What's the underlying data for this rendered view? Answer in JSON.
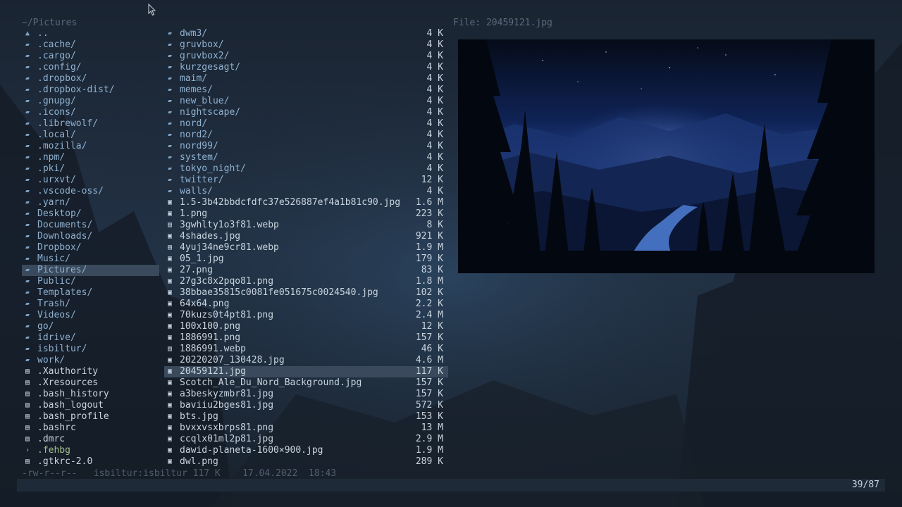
{
  "header": {
    "path": "~/Pictures",
    "preview_title": "File: 20459121.jpg"
  },
  "left_column": [
    {
      "name": "..",
      "type": "parent"
    },
    {
      "name": ".cache/",
      "type": "dir"
    },
    {
      "name": ".cargo/",
      "type": "dir"
    },
    {
      "name": ".config/",
      "type": "dir"
    },
    {
      "name": ".dropbox/",
      "type": "dir"
    },
    {
      "name": ".dropbox-dist/",
      "type": "dir"
    },
    {
      "name": ".gnupg/",
      "type": "dir"
    },
    {
      "name": ".icons/",
      "type": "dir"
    },
    {
      "name": ".librewolf/",
      "type": "dir"
    },
    {
      "name": ".local/",
      "type": "dir"
    },
    {
      "name": ".mozilla/",
      "type": "dir"
    },
    {
      "name": ".npm/",
      "type": "dir"
    },
    {
      "name": ".pki/",
      "type": "dir"
    },
    {
      "name": ".urxvt/",
      "type": "dir"
    },
    {
      "name": ".vscode-oss/",
      "type": "dir"
    },
    {
      "name": ".yarn/",
      "type": "dir"
    },
    {
      "name": "Desktop/",
      "type": "dir"
    },
    {
      "name": "Documents/",
      "type": "dir"
    },
    {
      "name": "Downloads/",
      "type": "dir"
    },
    {
      "name": "Dropbox/",
      "type": "dir"
    },
    {
      "name": "Music/",
      "type": "dir"
    },
    {
      "name": "Pictures/",
      "type": "dir",
      "selected": true
    },
    {
      "name": "Public/",
      "type": "dir"
    },
    {
      "name": "Templates/",
      "type": "dir"
    },
    {
      "name": "Trash/",
      "type": "dir"
    },
    {
      "name": "Videos/",
      "type": "dir"
    },
    {
      "name": "go/",
      "type": "dir"
    },
    {
      "name": "idrive/",
      "type": "dir"
    },
    {
      "name": "isbiltur/",
      "type": "dir"
    },
    {
      "name": "work/",
      "type": "dir"
    },
    {
      "name": ".Xauthority",
      "type": "file"
    },
    {
      "name": ".Xresources",
      "type": "file"
    },
    {
      "name": ".bash_history",
      "type": "file"
    },
    {
      "name": ".bash_logout",
      "type": "file"
    },
    {
      "name": ".bash_profile",
      "type": "file"
    },
    {
      "name": ".bashrc",
      "type": "file"
    },
    {
      "name": ".dmrc",
      "type": "file"
    },
    {
      "name": ".fehbg",
      "type": "exec"
    },
    {
      "name": ".gtkrc-2.0",
      "type": "file"
    }
  ],
  "middle_column": [
    {
      "name": "dwm3/",
      "size": "4 K",
      "type": "dir"
    },
    {
      "name": "gruvbox/",
      "size": "4 K",
      "type": "dir"
    },
    {
      "name": "gruvbox2/",
      "size": "4 K",
      "type": "dir"
    },
    {
      "name": "kurzgesagt/",
      "size": "4 K",
      "type": "dir"
    },
    {
      "name": "maim/",
      "size": "4 K",
      "type": "dir"
    },
    {
      "name": "memes/",
      "size": "4 K",
      "type": "dir"
    },
    {
      "name": "new_blue/",
      "size": "4 K",
      "type": "dir"
    },
    {
      "name": "nightscape/",
      "size": "4 K",
      "type": "dir"
    },
    {
      "name": "nord/",
      "size": "4 K",
      "type": "dir"
    },
    {
      "name": "nord2/",
      "size": "4 K",
      "type": "dir"
    },
    {
      "name": "nord99/",
      "size": "4 K",
      "type": "dir"
    },
    {
      "name": "system/",
      "size": "4 K",
      "type": "dir"
    },
    {
      "name": "tokyo_night/",
      "size": "4 K",
      "type": "dir"
    },
    {
      "name": "twitter/",
      "size": "12 K",
      "type": "dir"
    },
    {
      "name": "walls/",
      "size": "4 K",
      "type": "dir"
    },
    {
      "name": "1.5-3b42bbdcfdfc37e526887ef4a1b81c90.jpg",
      "size": "1.6 M",
      "type": "image"
    },
    {
      "name": "1.png",
      "size": "223 K",
      "type": "image"
    },
    {
      "name": "3gwhlty1o3f81.webp",
      "size": "8 K",
      "type": "doc"
    },
    {
      "name": "4shades.jpg",
      "size": "921 K",
      "type": "image"
    },
    {
      "name": "4yuj34ne9cr81.webp",
      "size": "1.9 M",
      "type": "doc"
    },
    {
      "name": "05_1.jpg",
      "size": "179 K",
      "type": "image"
    },
    {
      "name": "27.png",
      "size": "83 K",
      "type": "image"
    },
    {
      "name": "27g3c8x2pqo81.png",
      "size": "1.8 M",
      "type": "image"
    },
    {
      "name": "38bbae35815c0081fe051675c0024540.jpg",
      "size": "102 K",
      "type": "image"
    },
    {
      "name": "64x64.png",
      "size": "2.2 K",
      "type": "image"
    },
    {
      "name": "70kuzs0t4pt81.png",
      "size": "2.4 M",
      "type": "image"
    },
    {
      "name": "100x100.png",
      "size": "12 K",
      "type": "image"
    },
    {
      "name": "1886991.png",
      "size": "157 K",
      "type": "image"
    },
    {
      "name": "1886991.webp",
      "size": "46 K",
      "type": "doc"
    },
    {
      "name": "20220207_130428.jpg",
      "size": "4.6 M",
      "type": "image"
    },
    {
      "name": "20459121.jpg",
      "size": "117 K",
      "type": "image",
      "selected": true
    },
    {
      "name": "Scotch_Ale_Du_Nord_Background.jpg",
      "size": "157 K",
      "type": "image"
    },
    {
      "name": "a3beskyzmbr81.jpg",
      "size": "157 K",
      "type": "image"
    },
    {
      "name": "baviiu2bges81.jpg",
      "size": "572 K",
      "type": "image"
    },
    {
      "name": "bts.jpg",
      "size": "153 K",
      "type": "image"
    },
    {
      "name": "bvxxvsxbrps81.png",
      "size": "13 M",
      "type": "image"
    },
    {
      "name": "ccqlx01ml2p81.jpg",
      "size": "2.9 M",
      "type": "image"
    },
    {
      "name": "dawid-planeta-1600×900.jpg",
      "size": "1.9 M",
      "type": "image"
    },
    {
      "name": "dwl.png",
      "size": "289 K",
      "type": "image"
    }
  ],
  "status": {
    "text": "-rw-r--r--   isbiltur:isbiltur 117 K    17.04.2022  18:43"
  },
  "footer": {
    "counter": "39/87"
  },
  "icons": {
    "parent": "arrow-up-icon",
    "dir": "folder-icon",
    "file": "file-icon",
    "exec": "terminal-icon",
    "image": "image-file-icon",
    "doc": "document-icon"
  },
  "colors": {
    "background": "#1b2530",
    "selection": "#3a4a5c",
    "directory": "#8fb1d0",
    "file": "#c9d4df",
    "executable": "#a3be8c",
    "muted": "#5b6a7c"
  }
}
